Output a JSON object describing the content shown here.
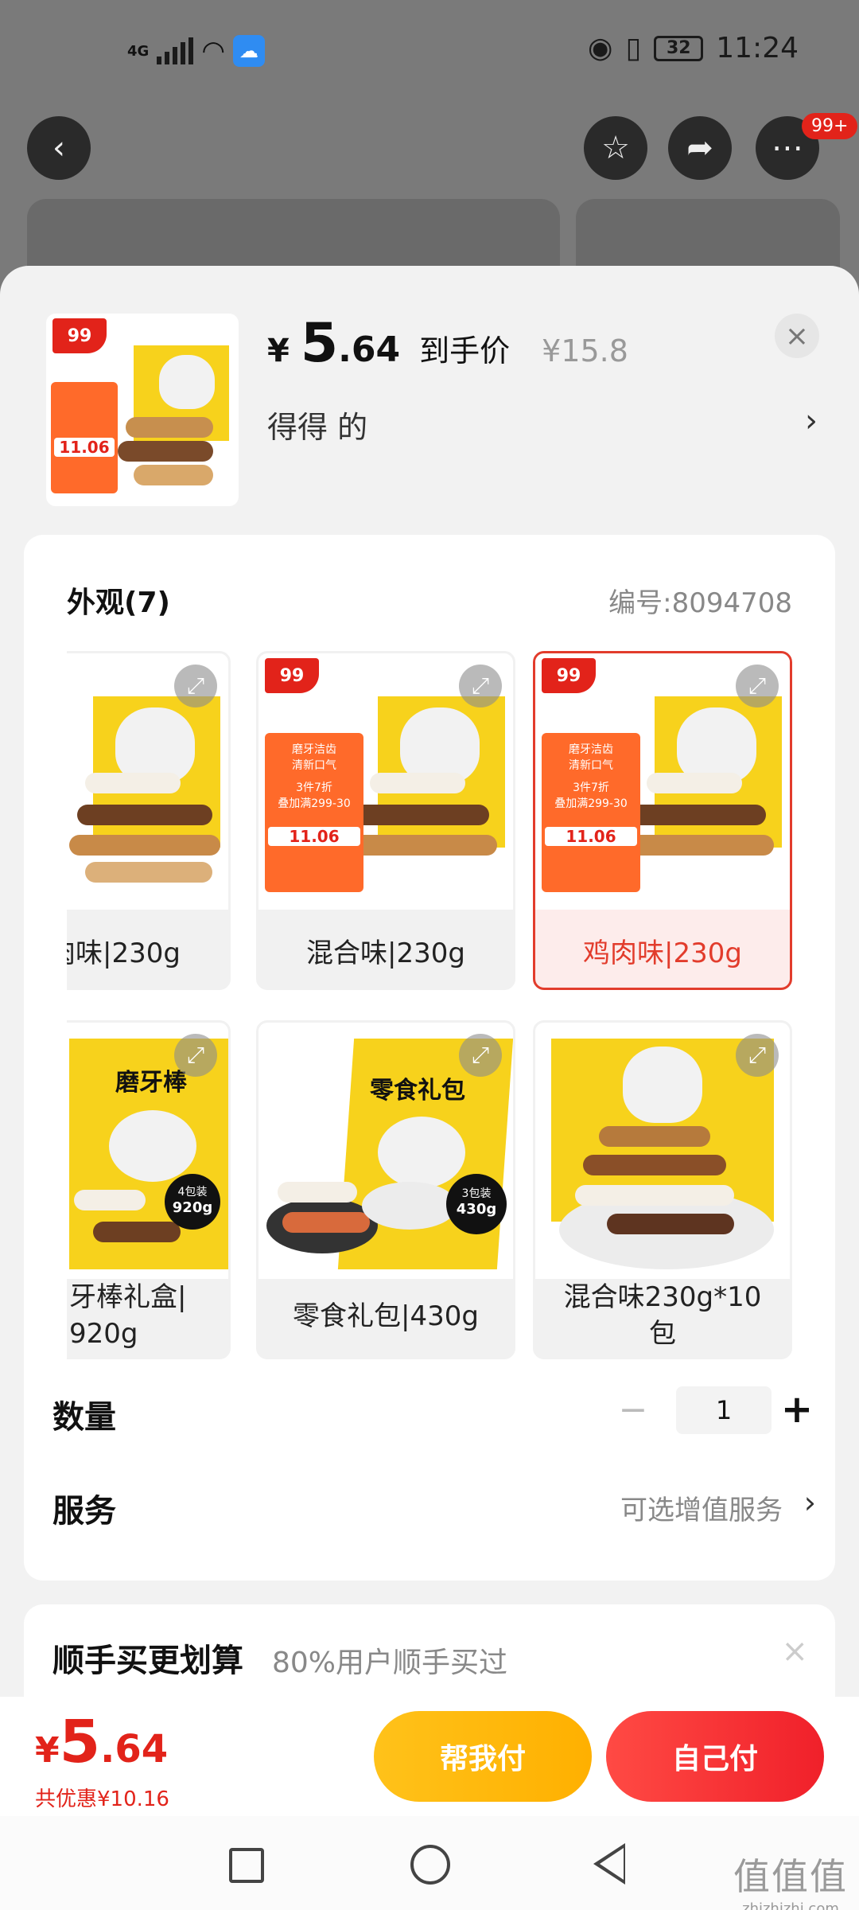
{
  "status_bar": {
    "network": "4G",
    "time": "11:24",
    "battery": "32",
    "colors": {
      "weather_badge": "#2f8cf2"
    }
  },
  "top_nav": {
    "badge": "99+",
    "icons": [
      "back-icon",
      "star-icon",
      "share-icon",
      "more-icon"
    ]
  },
  "sheet": {
    "price": {
      "symbol": "¥",
      "integer": "5",
      "decimal": ".64",
      "tag": "到手价",
      "original": "¥15.8"
    },
    "selection": {
      "text": "得得  的",
      "arrow": "›"
    },
    "close": "×",
    "thumbnail": {
      "jd_tag": "99",
      "promo_price": "11.06"
    }
  },
  "options": {
    "title": "外观(7)",
    "sku_no": "编号:8094708",
    "variants": [
      {
        "label": "肉味|230g"
      },
      {
        "label": "混合味|230g"
      },
      {
        "label": "鸡肉味|230g",
        "selected": true
      },
      {
        "label_line1": "牙棒礼盒|",
        "label_line2": "920g",
        "bag_title": "磨牙棒",
        "pack": "4包装",
        "weight": "920g"
      },
      {
        "label": "零食礼包|430g",
        "bag_title": "零食礼包",
        "pack": "3包装",
        "weight": "430g"
      },
      {
        "label_line1": "混合味230g*10",
        "label_line2": "包"
      }
    ],
    "promo_text": {
      "line1": "磨牙洁齿",
      "line2": "清新口气",
      "tag1": "3件7折",
      "tag2": "叠加满299-30",
      "price": "11.06",
      "jd_tag": "99"
    }
  },
  "quantity": {
    "label": "数量",
    "minus": "−",
    "value": "1",
    "plus": "+"
  },
  "service": {
    "label": "服务",
    "value": "可选增值服务",
    "arrow": "›"
  },
  "combo": {
    "title": "顺手买更划算",
    "subtitle": "80%用户顺手买过",
    "close": "×"
  },
  "footer": {
    "total": {
      "symbol": "¥",
      "integer": "5",
      "decimal": ".64"
    },
    "saving": "共优惠¥10.16",
    "help_pay": "帮我付",
    "self_pay": "自己付",
    "colors": {
      "accent_red": "#e2231a",
      "help_yellow": "#ffb000"
    }
  },
  "watermark": {
    "logo": "值值值",
    "url": "zhizhizhi.com"
  }
}
